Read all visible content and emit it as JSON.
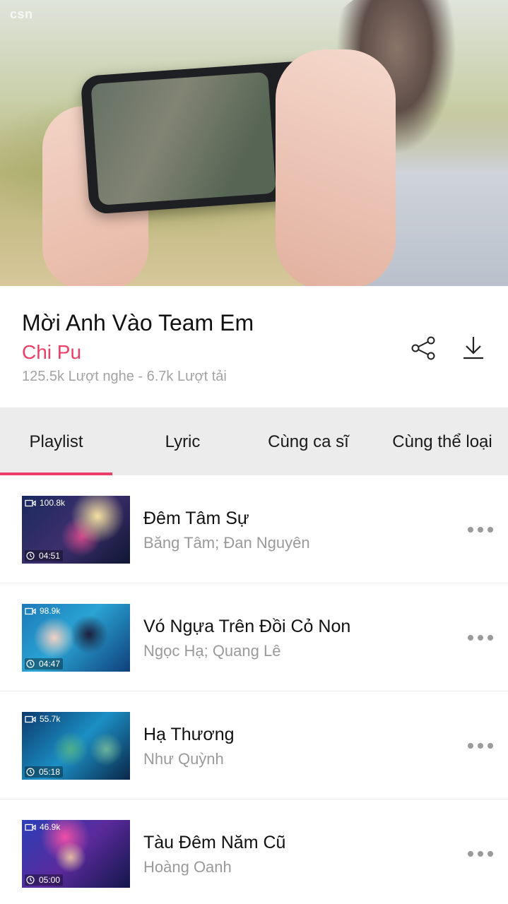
{
  "hero": {
    "logo": "csn"
  },
  "song": {
    "title": "Mời Anh Vào Team Em",
    "artist": "Chi Pu",
    "stats": "125.5k Lượt nghe - 6.7k Lượt tải",
    "icons": {
      "share": "share-icon",
      "download": "download-icon"
    }
  },
  "tabs": [
    {
      "label": "Playlist",
      "active": true
    },
    {
      "label": "Lyric",
      "active": false
    },
    {
      "label": "Cùng ca sĩ",
      "active": false
    },
    {
      "label": "Cùng thể loại",
      "active": false
    }
  ],
  "accent_color": "#ec3f67",
  "playlist": [
    {
      "title": "Đêm Tâm Sự",
      "artist": "Băng Tâm; Đan Nguyên",
      "views": "100.8k",
      "duration": "04:51"
    },
    {
      "title": "Vó Ngựa Trên Đồi Cỏ Non",
      "artist": "Ngọc Hạ; Quang Lê",
      "views": "98.9k",
      "duration": "04:47"
    },
    {
      "title": "Hạ Thương",
      "artist": "Như Quỳnh",
      "views": "55.7k",
      "duration": "05:18"
    },
    {
      "title": "Tàu Đêm Năm Cũ",
      "artist": "Hoàng Oanh",
      "views": "46.9k",
      "duration": "05:00"
    }
  ]
}
